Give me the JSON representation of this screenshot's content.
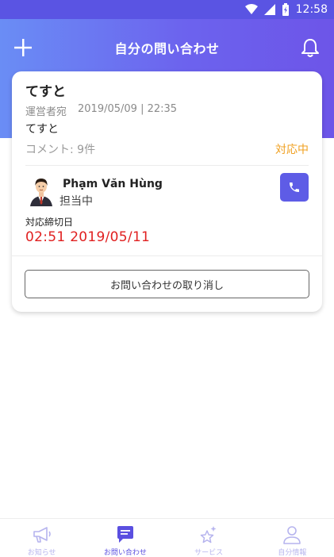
{
  "status_bar": {
    "time": "12:58"
  },
  "header": {
    "title": "自分の問い合わせ"
  },
  "card": {
    "title": "てすと",
    "sender": "運営者宛",
    "datetime": "2019/05/09 | 22:35",
    "body": "てすと",
    "comment": "コメント: 9件",
    "status": "対応中",
    "assignee": {
      "name": "Phạm Văn Hùng",
      "role": "担当中"
    },
    "deadline_label": "対応締切日",
    "deadline_value": "02:51 2019/05/11",
    "cancel_button": "お問い合わせの取り消し"
  },
  "tabbar": {
    "tabs": [
      {
        "label": "お知らせ",
        "icon": "megaphone-icon",
        "active": false
      },
      {
        "label": "お問い合わせ",
        "icon": "chat-icon",
        "active": true
      },
      {
        "label": "サービス",
        "icon": "sparkle-star-icon",
        "active": false
      },
      {
        "label": "自分情報",
        "icon": "person-icon",
        "active": false
      }
    ]
  },
  "colors": {
    "accent": "#5e5ce6",
    "status_orange": "#f0a020",
    "deadline_red": "#e02020",
    "tab_inactive": "#b6b4ee"
  }
}
